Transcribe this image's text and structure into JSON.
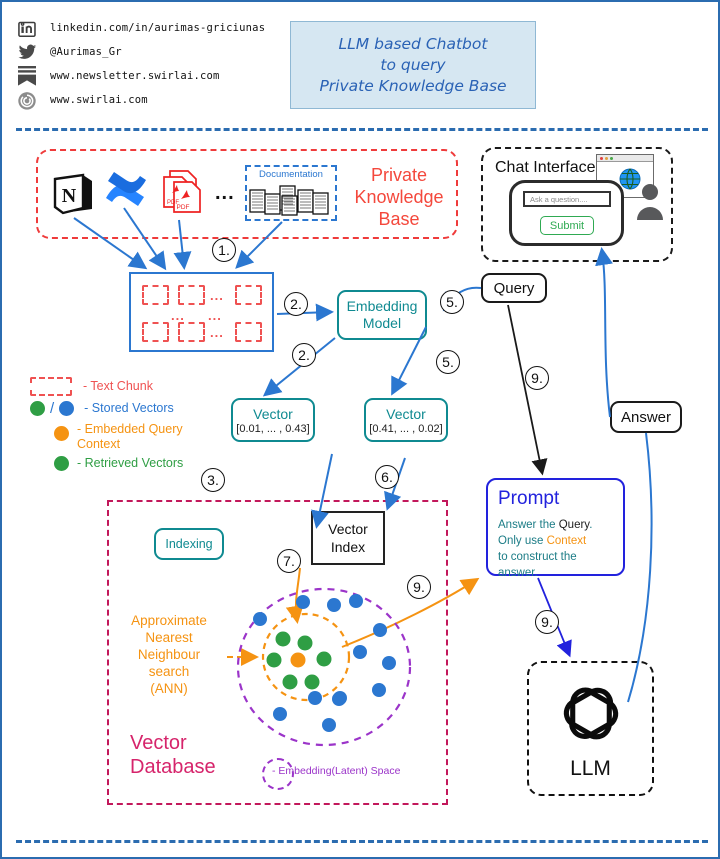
{
  "header": {
    "links": [
      {
        "icon": "linkedin-icon",
        "text": "linkedin.com/in/aurimas-griciunas"
      },
      {
        "icon": "twitter-icon",
        "text": "@Aurimas_Gr"
      },
      {
        "icon": "newsletter-icon",
        "text": "www.newsletter.swirlai.com"
      },
      {
        "icon": "swirl-logo-icon",
        "text": "www.swirlai.com"
      }
    ],
    "title_lines": [
      "LLM based Chatbot",
      "to query",
      "Private Knowledge Base"
    ],
    "title_bg": "#d6e7f2",
    "title_color": "#2a62b5"
  },
  "private_knowledge_base": {
    "label_lines": [
      "Private",
      "Knowledge",
      "Base"
    ],
    "label_color": "#f4483c",
    "sources": [
      "notion-icon",
      "confluence-icon",
      "pdf-icon",
      "documentation-icon"
    ],
    "documentation_label": "Documentation",
    "ellipsis": "..."
  },
  "chat_interface": {
    "title": "Chat Interface",
    "input_placeholder": "Ask a question....",
    "submit_label": "Submit",
    "submit_color": "#2faa52"
  },
  "chunk_grid": {
    "row_dots": "...",
    "col_dots": "...",
    "chunk_color": "#ef5252",
    "border_color": "#2b77d0"
  },
  "embedding_model": {
    "label_lines": [
      "Embedding",
      "Model"
    ],
    "color": "#0f8a91"
  },
  "vectors": [
    {
      "title": "Vector",
      "value": "[0.01, ... , 0.43]"
    },
    {
      "title": "Vector",
      "value": "[0.41, ... , 0.02]"
    }
  ],
  "legend": [
    {
      "swatch": "text-chunk-swatch",
      "label": "- Text Chunk",
      "color": "#ef5252"
    },
    {
      "swatch": "stored-vectors-swatch",
      "label": "- Stored Vectors",
      "color": "#2b77d0",
      "separator": "/"
    },
    {
      "swatch": "embedded-query-swatch",
      "label": "- Embedded Query Context",
      "color": "#f59312"
    },
    {
      "swatch": "retrieved-vectors-swatch",
      "label": "- Retrieved Vectors",
      "color": "#2f9e44"
    }
  ],
  "vector_database": {
    "label_lines": [
      "Vector",
      "Database"
    ],
    "label_color": "#d6246b",
    "indexing_label": "Indexing",
    "vector_index_lines": [
      "Vector",
      "Index"
    ],
    "ann_lines": [
      "Approximate",
      "Nearest",
      "Neighbour",
      "search",
      "(ANN)"
    ],
    "ann_color": "#f59312",
    "latent_space_label": "- Embedding(Latent) Space",
    "latent_space_color": "#9b34c9"
  },
  "query_box": {
    "label": "Query"
  },
  "answer_box": {
    "label": "Answer"
  },
  "prompt": {
    "title": "Prompt",
    "line1_a": "Answer the ",
    "line1_b": "Query",
    "line1_c": ".",
    "line2_a": "Only use ",
    "line2_b": "Context",
    "line3": "to construct the answer.",
    "title_color": "#2222dd"
  },
  "llm": {
    "label": "LLM",
    "icon": "openai-logo-icon"
  },
  "steps": [
    {
      "id": "step-1",
      "label": "1."
    },
    {
      "id": "step-2a",
      "label": "2."
    },
    {
      "id": "step-2b",
      "label": "2."
    },
    {
      "id": "step-3",
      "label": "3."
    },
    {
      "id": "step-5a",
      "label": "5."
    },
    {
      "id": "step-5b",
      "label": "5."
    },
    {
      "id": "step-6",
      "label": "6."
    },
    {
      "id": "step-7",
      "label": "7."
    },
    {
      "id": "step-9a",
      "label": "9."
    },
    {
      "id": "step-9b",
      "label": "9."
    },
    {
      "id": "step-9c",
      "label": "9."
    }
  ],
  "colors": {
    "blue_arrow": "#2b77d0",
    "orange": "#f59312",
    "purple": "#9b34c9",
    "green": "#2f9e44",
    "crimson": "#c2185b",
    "frame": "#2b6cb0"
  }
}
